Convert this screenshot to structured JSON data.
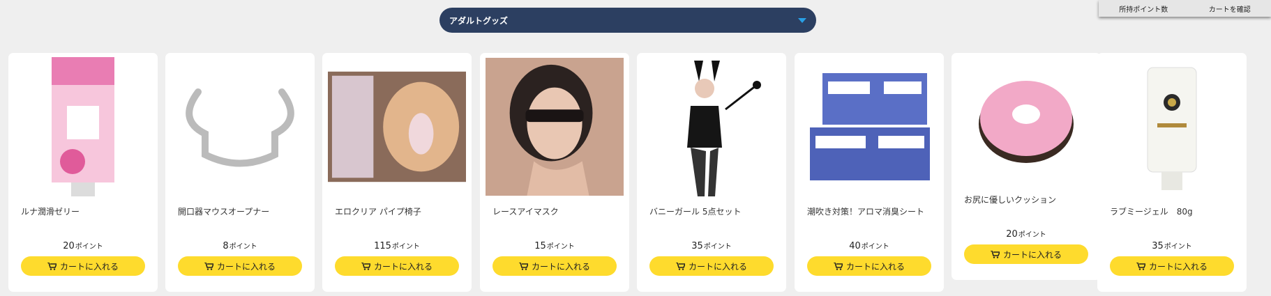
{
  "header": {
    "points_link": "所持ポイント数",
    "cart_link": "カートを確認",
    "category_selected": "アダルトグッズ"
  },
  "colors": {
    "background": "#efefef",
    "category_bg": "#2c3f61",
    "caret": "#29a0e6",
    "button_bg": "#fedb2d"
  },
  "button_label": "カートに入れる",
  "point_unit": "ポイント",
  "products": [
    {
      "name": "ルナ潤滑ゼリー",
      "points": "20",
      "icon": "lubricant-tube-image"
    },
    {
      "name": "開口器マウスオープナー",
      "points": "8",
      "icon": "mouth-opener-image"
    },
    {
      "name": "エロクリア パイプ椅子",
      "points": "115",
      "icon": "pipe-chair-product-image"
    },
    {
      "name": "レースアイマスク",
      "points": "15",
      "icon": "lace-eye-mask-image"
    },
    {
      "name": "バニーガール 5点セット",
      "points": "35",
      "icon": "bunny-costume-image"
    },
    {
      "name": "潮吹き対策！アロマ消臭シート",
      "points": "40",
      "icon": "deodorant-sheet-image"
    },
    {
      "name": "お尻に優しいクッション",
      "points": "20",
      "icon": "donut-cushion-image"
    },
    {
      "name": "ラブミージェル　80g",
      "points": "35",
      "icon": "love-gel-tube-image"
    }
  ]
}
